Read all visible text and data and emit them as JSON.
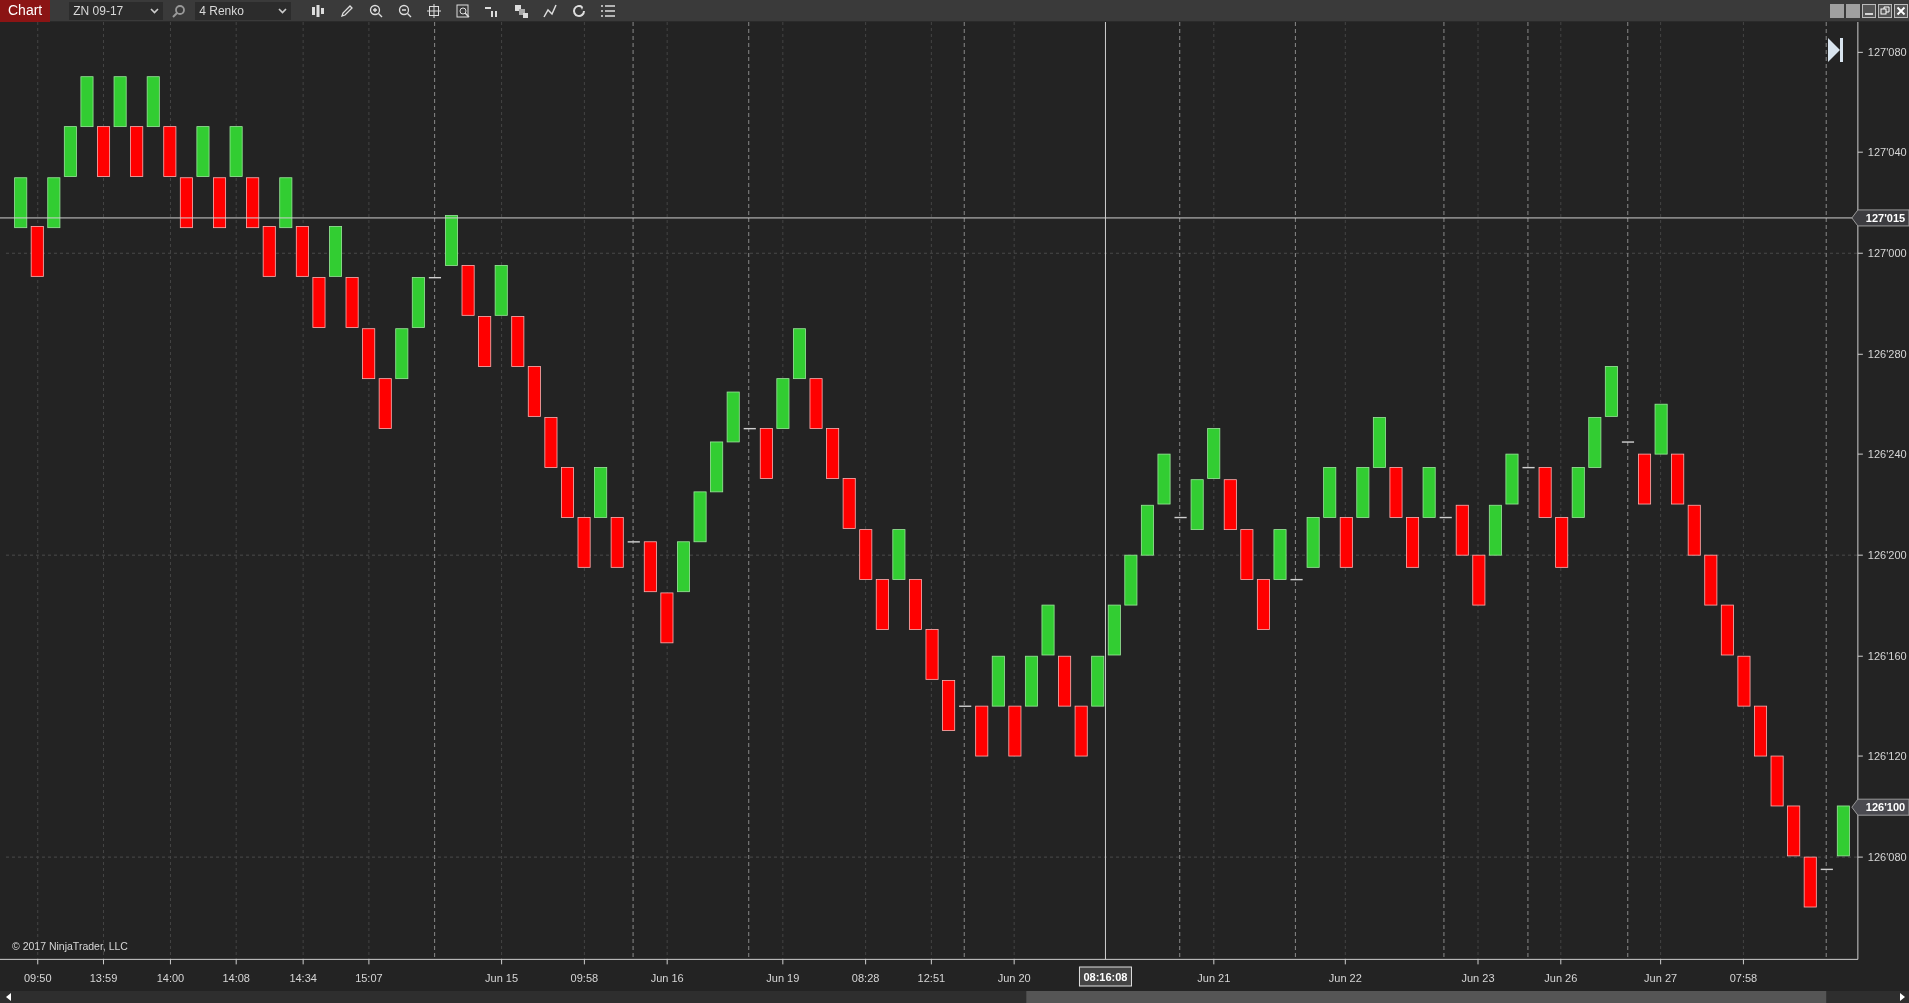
{
  "toolbar": {
    "tab": "Chart",
    "instrument": "ZN 09-17",
    "bar_type": "4 Renko"
  },
  "chart": {
    "y_ticks": [
      "127'080",
      "127'040",
      "127'000",
      "126'280",
      "126'240",
      "126'200",
      "126'160",
      "126'120",
      "126'080"
    ],
    "price_markers": [
      {
        "label": "127'015",
        "kind": "crosshair"
      },
      {
        "label": "126'100",
        "kind": "last"
      }
    ],
    "x_labels": [
      "09:50",
      "13:59",
      "14:00",
      "14:08",
      "14:34",
      "15:07",
      "Jun 15",
      "09:58",
      "Jun 16",
      "Jun 19",
      "08:28",
      "12:51",
      "Jun 20",
      "Jun 21",
      "Jun 22",
      "Jun 23",
      "Jun 26",
      "Jun 27",
      "07:58"
    ],
    "crosshair_time": "08:16:08",
    "copyright": "© 2017 NinjaTrader, LLC",
    "bricks": [
      {
        "kind": "up"
      },
      {
        "kind": "down"
      },
      {
        "kind": "up"
      },
      {
        "kind": "up"
      },
      {
        "kind": "up"
      },
      {
        "kind": "down"
      },
      {
        "kind": "up"
      },
      {
        "kind": "down"
      },
      {
        "kind": "up"
      },
      {
        "kind": "down"
      },
      {
        "kind": "down"
      },
      {
        "kind": "up"
      },
      {
        "kind": "down"
      },
      {
        "kind": "up"
      },
      {
        "kind": "down"
      },
      {
        "kind": "down"
      },
      {
        "kind": "up"
      },
      {
        "kind": "down"
      },
      {
        "kind": "down"
      },
      {
        "kind": "up"
      },
      {
        "kind": "down"
      },
      {
        "kind": "down"
      },
      {
        "kind": "down"
      },
      {
        "kind": "up"
      },
      {
        "kind": "up"
      },
      {
        "kind": "flat"
      },
      {
        "kind": "up"
      },
      {
        "kind": "down"
      },
      {
        "kind": "down"
      },
      {
        "kind": "up"
      },
      {
        "kind": "down"
      },
      {
        "kind": "down"
      },
      {
        "kind": "down"
      },
      {
        "kind": "down"
      },
      {
        "kind": "down"
      },
      {
        "kind": "up"
      },
      {
        "kind": "down"
      },
      {
        "kind": "flat"
      },
      {
        "kind": "down"
      },
      {
        "kind": "down"
      },
      {
        "kind": "up"
      },
      {
        "kind": "up"
      },
      {
        "kind": "up"
      },
      {
        "kind": "up"
      },
      {
        "kind": "flat"
      },
      {
        "kind": "down"
      },
      {
        "kind": "up"
      },
      {
        "kind": "up"
      },
      {
        "kind": "down"
      },
      {
        "kind": "down"
      },
      {
        "kind": "down"
      },
      {
        "kind": "down"
      },
      {
        "kind": "down"
      },
      {
        "kind": "up"
      },
      {
        "kind": "down"
      },
      {
        "kind": "down"
      },
      {
        "kind": "down"
      },
      {
        "kind": "flat"
      },
      {
        "kind": "down"
      },
      {
        "kind": "up"
      },
      {
        "kind": "down"
      },
      {
        "kind": "up"
      },
      {
        "kind": "up"
      },
      {
        "kind": "down"
      },
      {
        "kind": "down"
      },
      {
        "kind": "up"
      },
      {
        "kind": "up"
      },
      {
        "kind": "up"
      },
      {
        "kind": "up"
      },
      {
        "kind": "up"
      },
      {
        "kind": "flat"
      },
      {
        "kind": "up"
      },
      {
        "kind": "up"
      },
      {
        "kind": "down"
      },
      {
        "kind": "down"
      },
      {
        "kind": "down"
      },
      {
        "kind": "up"
      },
      {
        "kind": "flat"
      },
      {
        "kind": "up"
      },
      {
        "kind": "up"
      },
      {
        "kind": "down"
      },
      {
        "kind": "up"
      },
      {
        "kind": "up"
      },
      {
        "kind": "down"
      },
      {
        "kind": "down"
      },
      {
        "kind": "up"
      },
      {
        "kind": "flat"
      },
      {
        "kind": "down"
      },
      {
        "kind": "down"
      },
      {
        "kind": "up"
      },
      {
        "kind": "up"
      },
      {
        "kind": "flat"
      },
      {
        "kind": "down"
      },
      {
        "kind": "down"
      },
      {
        "kind": "up"
      },
      {
        "kind": "up"
      },
      {
        "kind": "up"
      },
      {
        "kind": "flat"
      },
      {
        "kind": "down"
      },
      {
        "kind": "up"
      },
      {
        "kind": "down"
      },
      {
        "kind": "down"
      },
      {
        "kind": "down"
      },
      {
        "kind": "down"
      },
      {
        "kind": "down"
      },
      {
        "kind": "down"
      },
      {
        "kind": "down"
      },
      {
        "kind": "down"
      },
      {
        "kind": "down"
      },
      {
        "kind": "flat"
      },
      {
        "kind": "up"
      }
    ]
  }
}
